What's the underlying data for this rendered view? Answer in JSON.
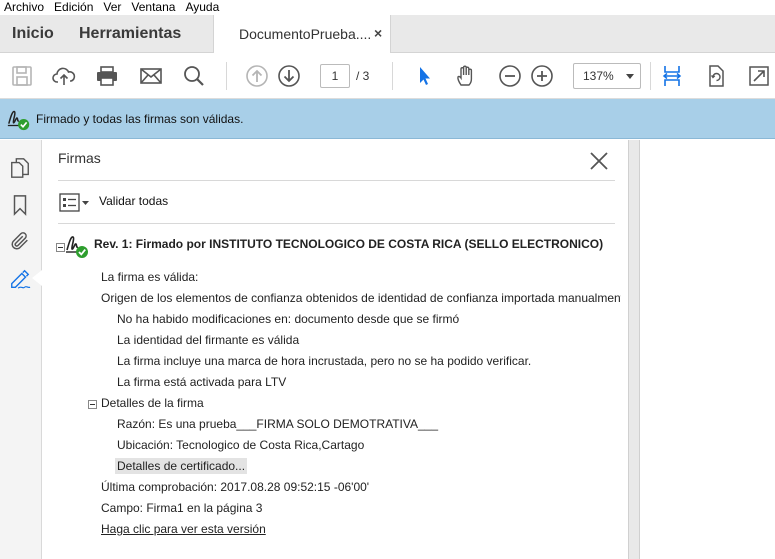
{
  "menu": [
    "Archivo",
    "Edición",
    "Ver",
    "Ventana",
    "Ayuda"
  ],
  "tabs": {
    "home": "Inicio",
    "tools": "Herramientas",
    "document": "DocumentoPrueba....",
    "close": "×"
  },
  "toolbar": {
    "page_current": "1",
    "page_total": "/ 3",
    "zoom": "137%",
    "accent_color": "#1473e6"
  },
  "banner": {
    "message": "Firmado y todas las firmas son válidas."
  },
  "panel": {
    "title": "Firmas",
    "validate_all": "Validar todas",
    "revision_title": "Rev. 1: Firmado por INSTITUTO TECNOLOGICO DE COSTA RICA (SELLO ELECTRONICO)",
    "lines": {
      "valid": "La firma es válida:",
      "origin": "Origen de los elementos de confianza obtenidos de identidad de confianza importada manualmente.",
      "no_mods": "No ha habido modificaciones en: documento desde que se firmó",
      "identity": "La identidad del firmante es válida",
      "timestamp": "La firma incluye una marca de hora incrustada, pero no se ha podido verificar.",
      "ltv": "La firma está activada para LTV",
      "details": "Detalles de la firma",
      "reason": "Razón: Es una prueba___FIRMA SOLO DEMOTRATIVA___",
      "location": "Ubicación: Tecnologico de Costa Rica,Cartago",
      "cert_details": "Detalles de certificado...",
      "last_check": "Última comprobación: 2017.08.28 09:52:15 -06'00'",
      "field": "Campo: Firma1 en la página 3",
      "view_version": "Haga clic para ver esta versión"
    }
  },
  "icons": [
    "save-icon",
    "upload-icon",
    "print-icon",
    "mail-icon",
    "search-icon",
    "page-up-icon",
    "page-down-icon",
    "select-arrow-icon",
    "hand-icon",
    "zoom-out-icon",
    "zoom-in-icon",
    "fit-width-icon",
    "rotate-page-icon",
    "fullscreen-icon",
    "pages-icon",
    "bookmark-icon",
    "attachment-icon",
    "signature-icon",
    "close-icon",
    "options-icon"
  ]
}
